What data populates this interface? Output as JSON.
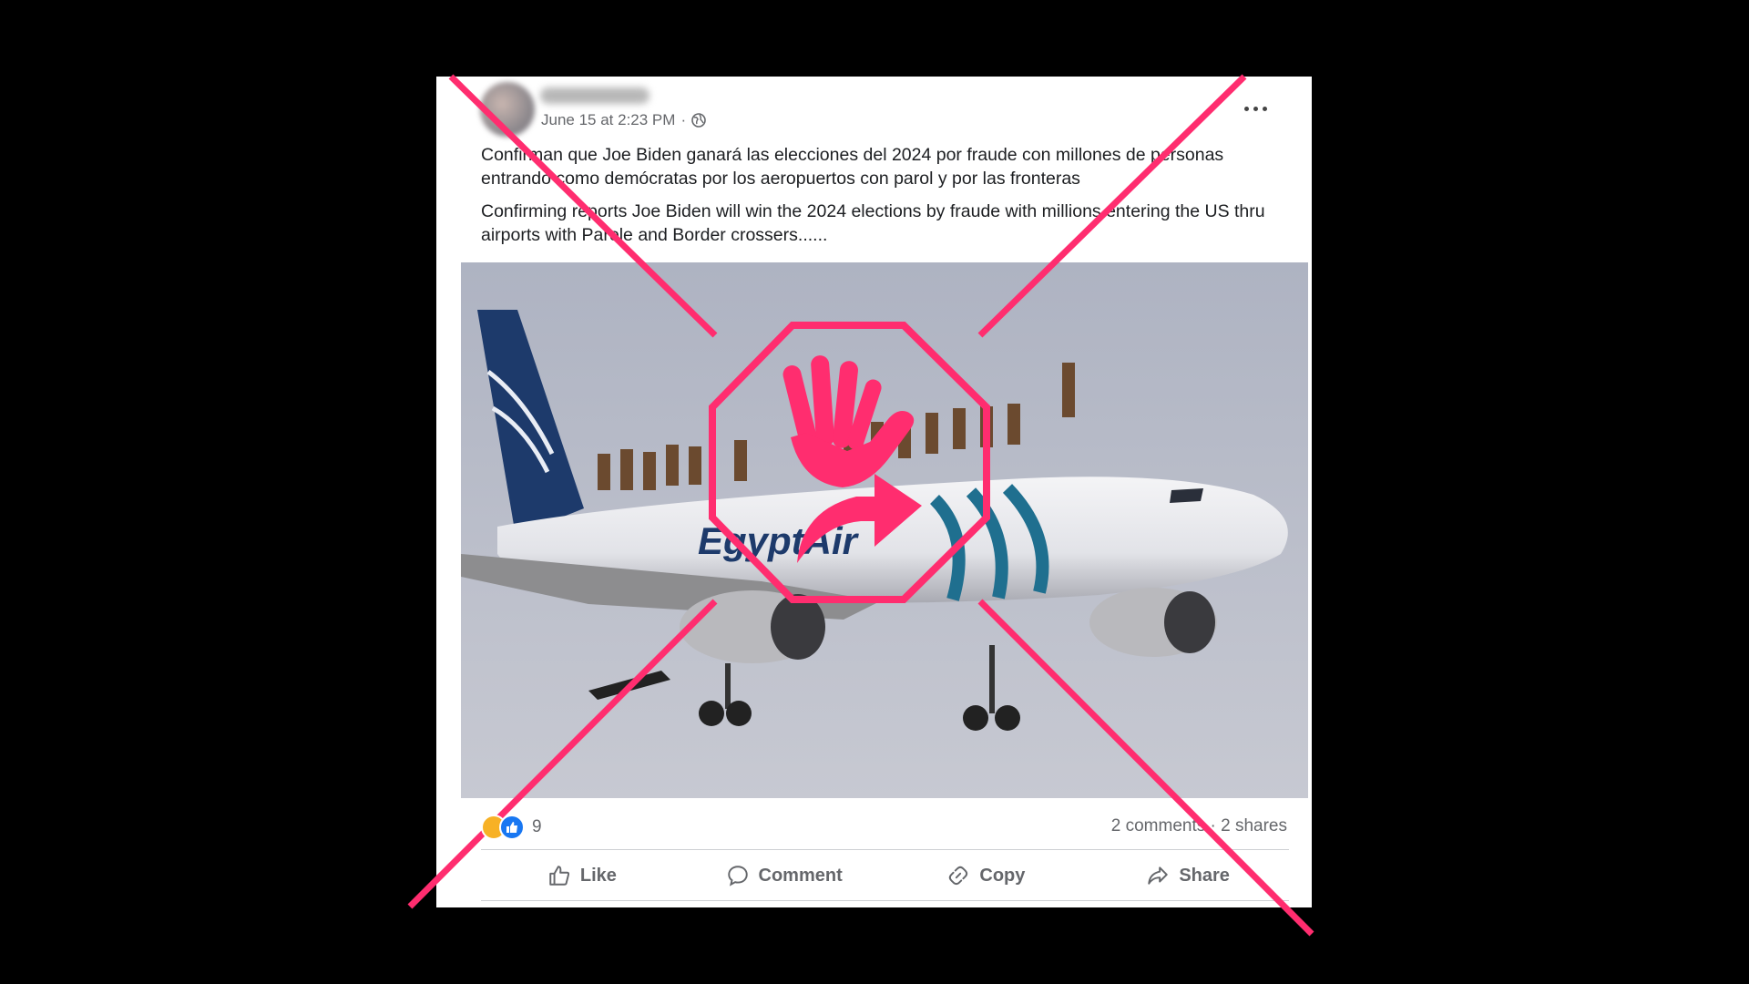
{
  "post": {
    "timestamp": "June 15 at 2:23 PM",
    "separator": "·",
    "audience_icon": "globe-icon",
    "text_spanish": "Confirman que Joe Biden ganará las elecciones del 2024 por fraude con millones de personas entrando como demócratas por los aeropuertos con parol y por las fronteras",
    "text_english": "Confirming reports Joe Biden will win the 2024 elections by fraude with millions entering the US thru airports with Parole and Border crossers......",
    "photo_airline_text": "EgyptAir"
  },
  "engagement": {
    "reaction_icons": [
      "haha-reaction-icon",
      "like-reaction-icon"
    ],
    "reaction_count": "9",
    "comments": "2 comments",
    "shares": "2 shares"
  },
  "actions": {
    "like": "Like",
    "comment": "Comment",
    "copy": "Copy",
    "share": "Share"
  },
  "overlay": {
    "color": "#ff2d6f",
    "badge_icon": "stop-hand-share-icon"
  }
}
